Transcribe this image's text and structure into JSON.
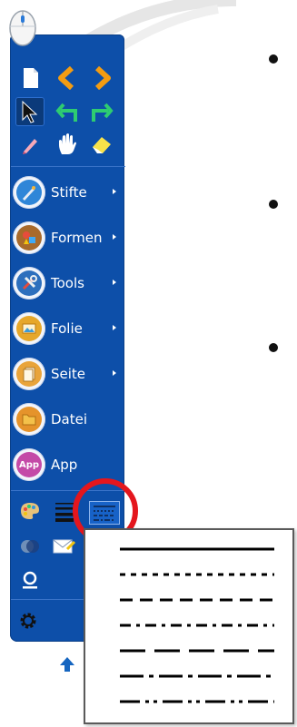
{
  "colors": {
    "toolbar_blue": "#0d4fa9",
    "highlight_red": "#e4161d",
    "accent_orange": "#f39c12",
    "accent_green": "#2ecc71"
  },
  "toolbar": {
    "menu_items": [
      {
        "label": "Stifte",
        "icon": "pen-tools-icon",
        "has_submenu": true
      },
      {
        "label": "Formen",
        "icon": "shapes-icon",
        "has_submenu": true
      },
      {
        "label": "Tools",
        "icon": "tools-icon",
        "has_submenu": true
      },
      {
        "label": "Folie",
        "icon": "slide-icon",
        "has_submenu": true
      },
      {
        "label": "Seite",
        "icon": "page-icon",
        "has_submenu": true
      },
      {
        "label": "Datei",
        "icon": "file-icon",
        "has_submenu": false
      },
      {
        "label": "App",
        "icon": "app-icon",
        "has_submenu": false
      }
    ],
    "app_badge": "App"
  },
  "line_style_popup": {
    "options": [
      "solid",
      "dotted",
      "short-dash",
      "dash-dot",
      "long-dash",
      "long-dash-dot",
      "long-dash-dot-dot"
    ]
  }
}
